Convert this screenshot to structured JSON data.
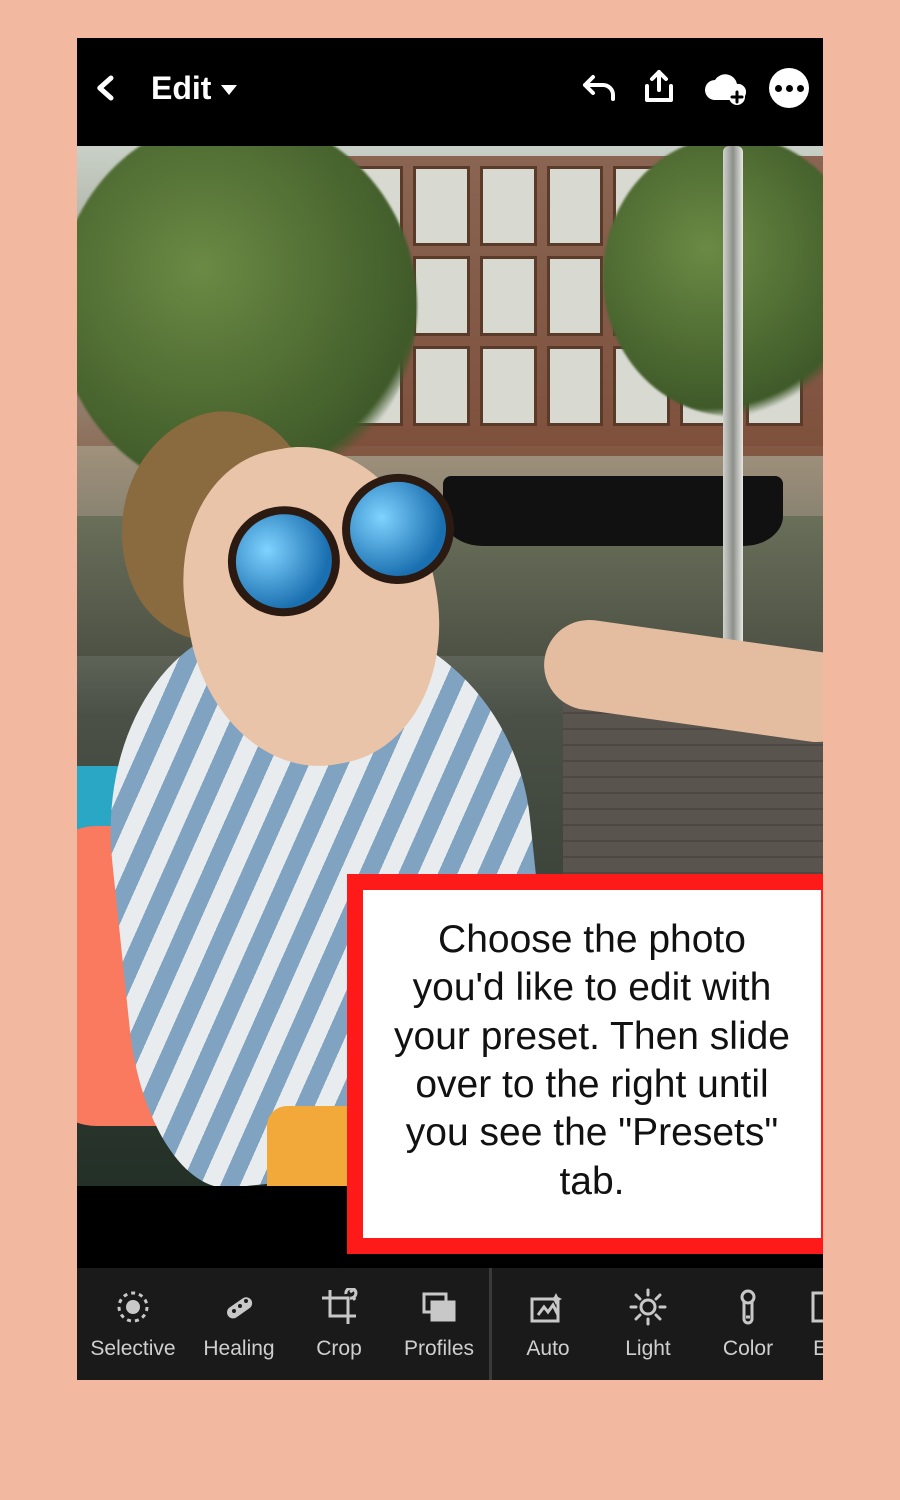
{
  "header": {
    "mode_label": "Edit"
  },
  "callout": {
    "text": "Choose the photo you'd like to edit with your preset. Then slide over to the right until you see the \"Presets\" tab."
  },
  "toolbar": {
    "items": [
      {
        "label": "Selective"
      },
      {
        "label": "Healing"
      },
      {
        "label": "Crop"
      },
      {
        "label": "Profiles"
      },
      {
        "label": "Auto"
      },
      {
        "label": "Light"
      },
      {
        "label": "Color"
      },
      {
        "label": "Ef"
      }
    ]
  },
  "colors": {
    "page_bg": "#f3b8a0",
    "callout_border": "#ff1a1a"
  }
}
